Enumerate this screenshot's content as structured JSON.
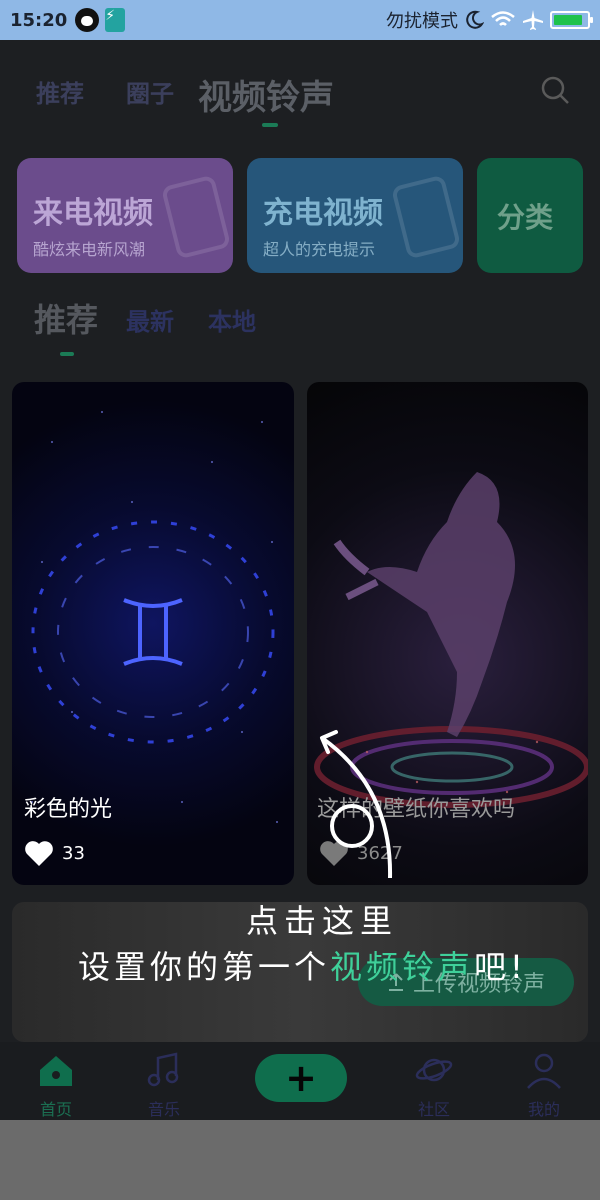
{
  "status_bar": {
    "time": "15:20",
    "dnd_label": "勿扰模式",
    "icons": [
      "qq-icon",
      "usb-icon",
      "moon-icon",
      "wifi-icon",
      "airplane-icon",
      "battery-icon"
    ],
    "battery_fill": 0.9
  },
  "header": {
    "tabs": [
      {
        "label": "推荐"
      },
      {
        "label": "圈子"
      },
      {
        "label": "视频铃声"
      }
    ]
  },
  "category_cards": [
    {
      "title": "来电视频",
      "subtitle": "酷炫来电新风潮"
    },
    {
      "title": "充电视频",
      "subtitle": "超人的充电提示"
    },
    {
      "title": "分类"
    }
  ],
  "sub_tabs": [
    {
      "label": "推荐"
    },
    {
      "label": "最新"
    },
    {
      "label": "本地"
    }
  ],
  "videos": [
    {
      "caption": "彩色的光",
      "likes": "33"
    },
    {
      "caption": "这样的壁纸你喜欢吗",
      "likes": "3627"
    }
  ],
  "upload_button": {
    "label": "上传视频铃声"
  },
  "hint": {
    "line1": "点击这里",
    "line2_prefix": "设置你的第一个",
    "line2_accent": "视频铃声",
    "line2_suffix": "吧!"
  },
  "bottom_nav": [
    {
      "label": "首页"
    },
    {
      "label": "音乐"
    },
    {
      "label": "社区"
    },
    {
      "label": "我的"
    }
  ],
  "colors": {
    "accent_green": "#3fd09a",
    "status_bar": "#8fb8e6",
    "app_background": "#1d1f22"
  }
}
